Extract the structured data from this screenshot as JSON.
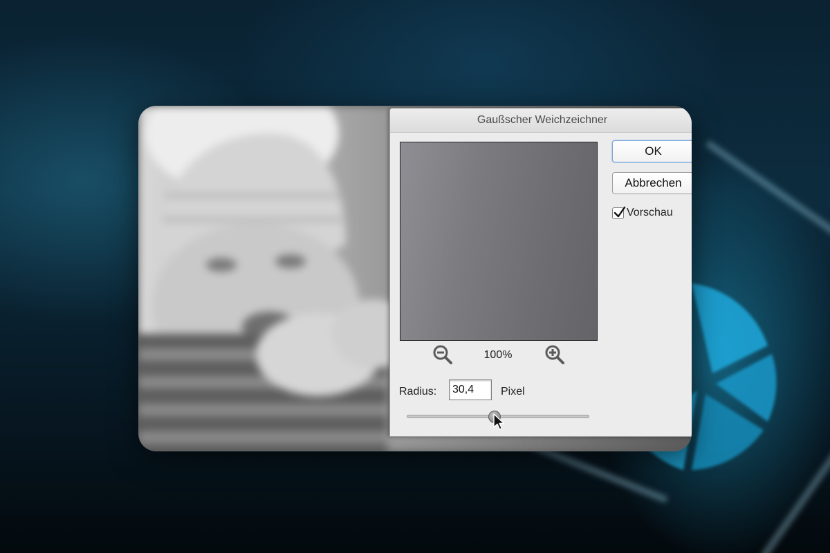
{
  "dialog": {
    "title": "Gaußscher Weichzeichner",
    "ok_label": "OK",
    "cancel_label": "Abbrechen",
    "preview_label": "Vorschau",
    "preview_checked": true,
    "zoom_level": "100%",
    "radius_label": "Radius:",
    "radius_value": "30,4",
    "radius_unit": "Pixel",
    "slider_fraction": 0.48
  },
  "icons": {
    "zoom_out": "zoom-out-icon",
    "zoom_in": "zoom-in-icon",
    "checkmark": "checkmark-icon",
    "cursor": "mouse-pointer-icon"
  },
  "colors": {
    "dialog_bg": "#ececec",
    "selection": "#b3d3f5",
    "backdrop_accent": "#1fa9d6"
  }
}
